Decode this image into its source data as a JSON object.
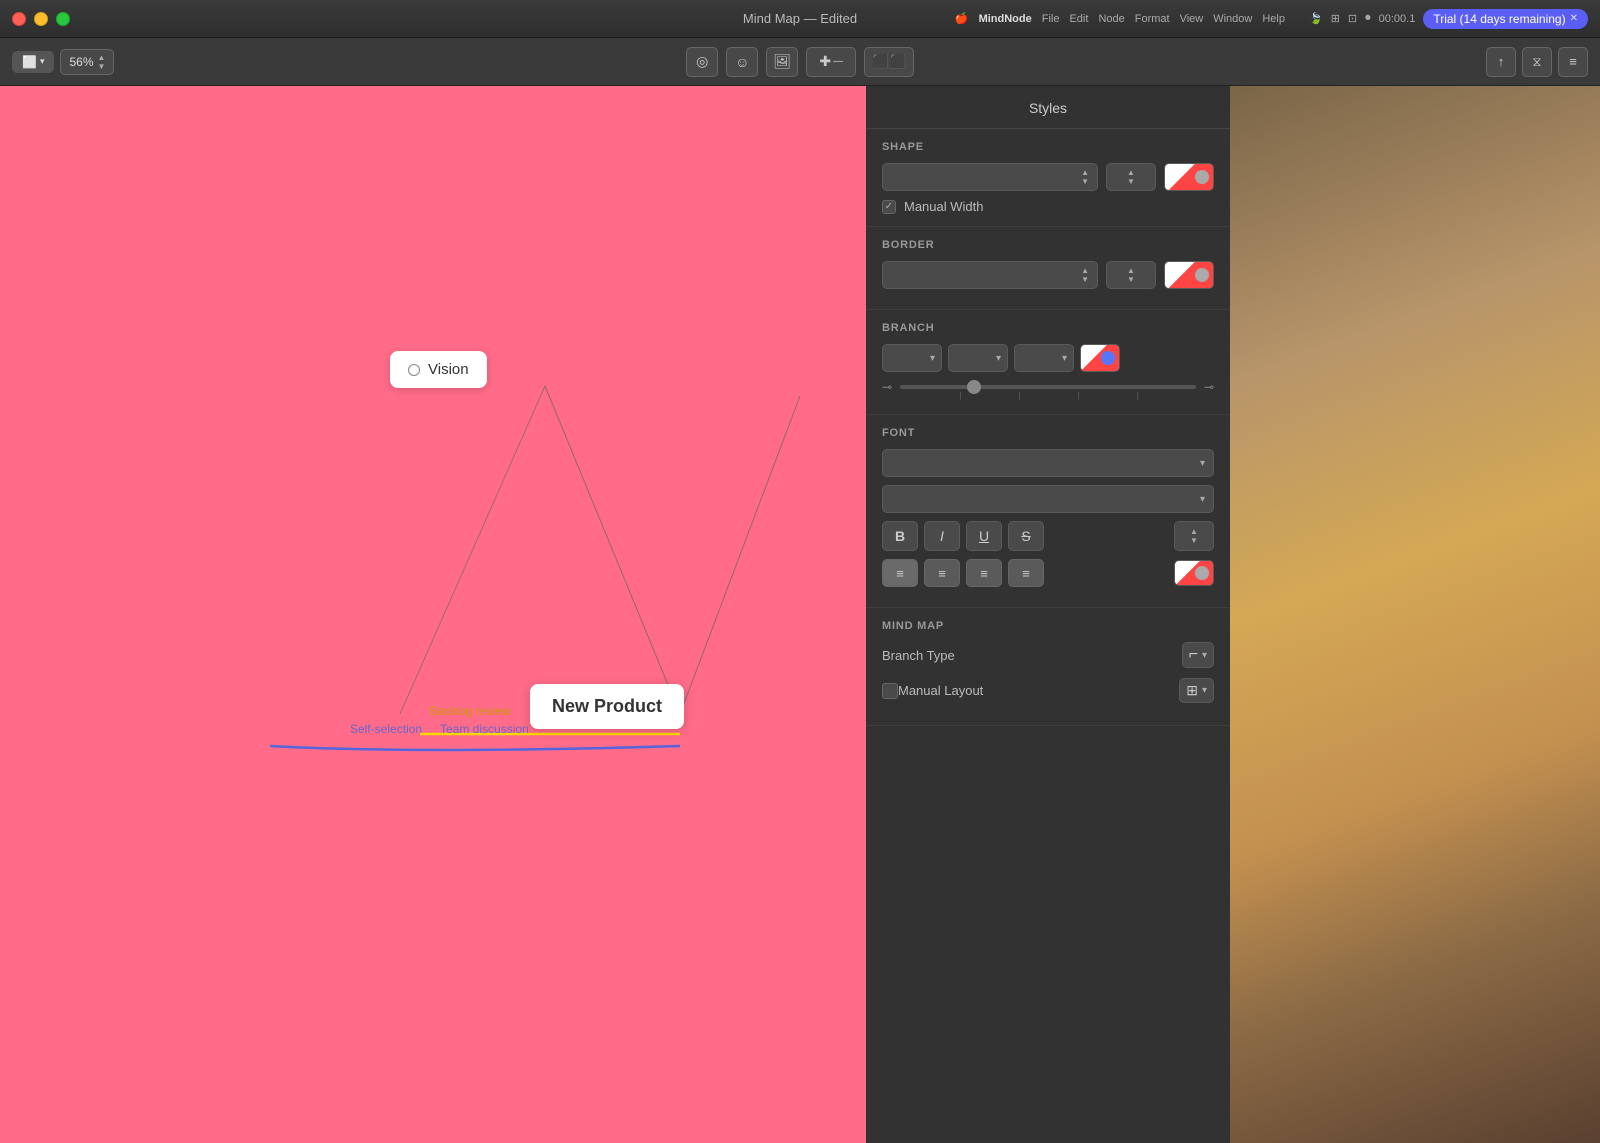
{
  "titlebar": {
    "app_name": "MindNode",
    "title": "Mind Map — Edited",
    "trial_label": "Trial (14 days remaining)",
    "trial_close": "✕",
    "time": "00:00.1"
  },
  "toolbar": {
    "view_btn": "⬜",
    "zoom_level": "56%",
    "checkmark_icon": "✓",
    "smiley_icon": "☺",
    "image_icon": "⬛",
    "add_icon": "+",
    "link_icon": "⬛⬛",
    "export_icon": "↑",
    "filter_icon": "⧖",
    "list_icon": "≡"
  },
  "panel": {
    "title": "Styles",
    "shape_section": "SHAPE",
    "manual_width_label": "Manual Width",
    "border_section": "BORDER",
    "branch_section": "BRANCH",
    "font_section": "FONT",
    "mind_map_section": "MIND MAP",
    "branch_type_label": "Branch Type",
    "manual_layout_label": "Manual Layout"
  },
  "canvas": {
    "node_vision": "Vision",
    "node_new_product": "New Product",
    "label_backlog": "Backlog review",
    "label_team": "Team discussion",
    "label_self": "Self-selection"
  }
}
